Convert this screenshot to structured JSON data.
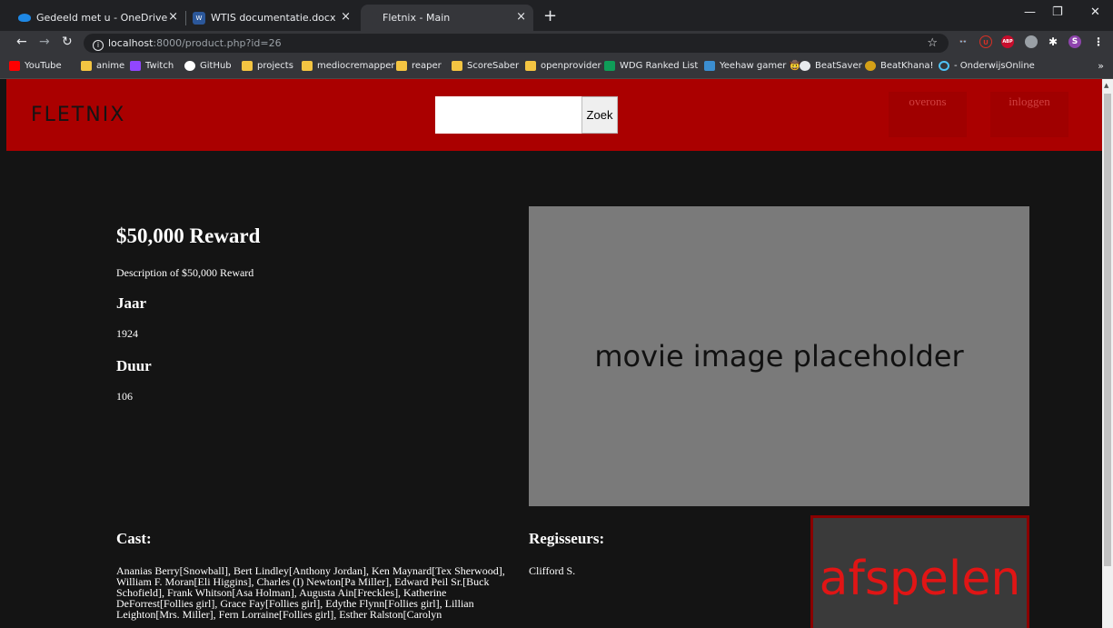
{
  "browser": {
    "tabs": [
      {
        "title": "Gedeeld met u - OneDrive",
        "icon": "onedrive-cloud-icon"
      },
      {
        "title": "WTIS documentatie.docx",
        "icon": "word-icon"
      },
      {
        "title": "Fletnix - Main",
        "icon": "page-icon",
        "active": true
      }
    ],
    "close_glyph": "×",
    "new_tab": "+",
    "window": {
      "minimize": "—",
      "maximize": "❐",
      "close": "✕"
    },
    "url": {
      "host": "localhost",
      "path": ":8000/product.php?id=26"
    },
    "extensions": [
      {
        "name": "glasses-extension-icon",
        "label": "👓",
        "color": "#35363a"
      },
      {
        "name": "ublock-extension-icon",
        "label": "U",
        "color": "#800000"
      },
      {
        "name": "adblock-plus-extension-icon",
        "label": "ABP",
        "color": "#c70d2c"
      },
      {
        "name": "extension-gray-icon",
        "label": "",
        "color": "#9aa0a6"
      },
      {
        "name": "puzzle-extensions-icon",
        "label": "✱",
        "color": "#35363a"
      },
      {
        "name": "profile-avatar",
        "label": "S",
        "color": "#8e44ad"
      }
    ],
    "bookmarks": [
      {
        "label": "YouTube",
        "color": "#ff0000"
      },
      {
        "label": "anime",
        "color": "#f4c542"
      },
      {
        "label": "Twitch",
        "color": "#9146ff"
      },
      {
        "label": "GitHub",
        "color": "#ffffff"
      },
      {
        "label": "projects",
        "color": "#f4c542"
      },
      {
        "label": "mediocremapper",
        "color": "#f4c542"
      },
      {
        "label": "reaper",
        "color": "#f4c542"
      },
      {
        "label": "ScoreSaber",
        "color": "#f4c542"
      },
      {
        "label": "openprovider",
        "color": "#f4c542"
      },
      {
        "label": "WDG Ranked List",
        "color": "#0f9d58"
      },
      {
        "label": "Yeehaw gamer 🤠",
        "color": "#3b8ed0"
      },
      {
        "label": "BeatSaver",
        "color": "#e8eaed"
      },
      {
        "label": "BeatKhana!",
        "color": "#d4a017"
      },
      {
        "label": "- OnderwijsOnline",
        "color": "#4fc3f7"
      }
    ],
    "bookmarks_more": "»"
  },
  "page": {
    "logo": "FLETNIX",
    "search_button": "Zoek",
    "nav": {
      "about": "overons",
      "login": "inloggen"
    },
    "movie": {
      "title": "$50,000 Reward",
      "description": "Description of $50,000 Reward",
      "year_label": "Jaar",
      "year": "1924",
      "duration_label": "Duur",
      "duration": "106",
      "image_placeholder": "movie image placeholder",
      "cast_label": "Cast:",
      "cast": "Ananias Berry[Snowball], Bert Lindley[Anthony Jordan], Ken Maynard[Tex Sherwood], William F. Moran[Eli Higgins], Charles (I) Newton[Pa Miller], Edward Peil Sr.[Buck Schofield], Frank Whitson[Asa Holman], Augusta Ain[Freckles], Katherine DeForrest[Follies girl], Grace Fay[Follies girl], Edythe Flynn[Follies girl], Lillian Leighton[Mrs. Miller], Fern Lorraine[Follies girl], Esther Ralston[Carolyn",
      "directors_label": "Regisseurs:",
      "director": "Clifford S.",
      "play_button": "afspelen"
    }
  }
}
